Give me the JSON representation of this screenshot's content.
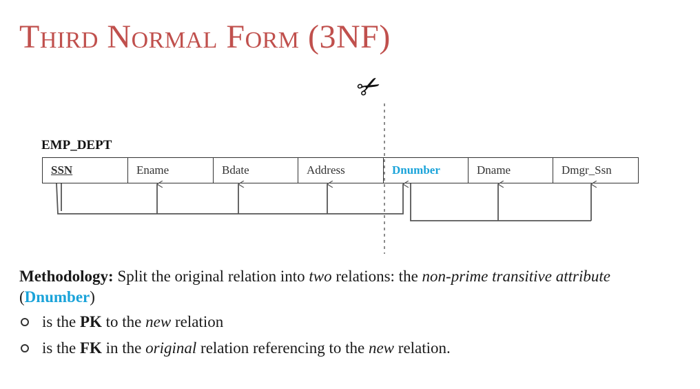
{
  "title": "Third Normal Form (3NF)",
  "relation": {
    "name": "EMP_DEPT",
    "attributes": [
      "SSN",
      "Ename",
      "Bdate",
      "Address",
      "Dnumber",
      "Dname",
      "Dmgr_Ssn"
    ],
    "primary_key": "SSN",
    "highlighted": "Dnumber"
  },
  "dependencies": [
    {
      "from": "SSN",
      "to": [
        "Ename",
        "Bdate",
        "Address",
        "Dnumber"
      ]
    },
    {
      "from": "Dnumber",
      "to": [
        "Dname",
        "Dmgr_Ssn"
      ]
    }
  ],
  "split_icon": "scissors-icon",
  "colors": {
    "title": "#c0504d",
    "highlight": "#1aa3d9"
  },
  "methodology": {
    "label": "Methodology:",
    "text_1": " Split the original relation into ",
    "em_1": "two",
    "text_2": " relations: the ",
    "em_2": "non-prime transitive attribute",
    "text_3": " (",
    "attr": "Dnumber",
    "text_4": ")"
  },
  "bullets": [
    {
      "pre": "is the ",
      "strong": "PK",
      "mid": " to the ",
      "em": "new",
      "post": " relation",
      "tail_em": "",
      "tail": ""
    },
    {
      "pre": "is the ",
      "strong": "FK",
      "mid": " in the ",
      "em": "original",
      "post": " relation referencing to the ",
      "tail_em": "new",
      "tail": " relation."
    }
  ]
}
